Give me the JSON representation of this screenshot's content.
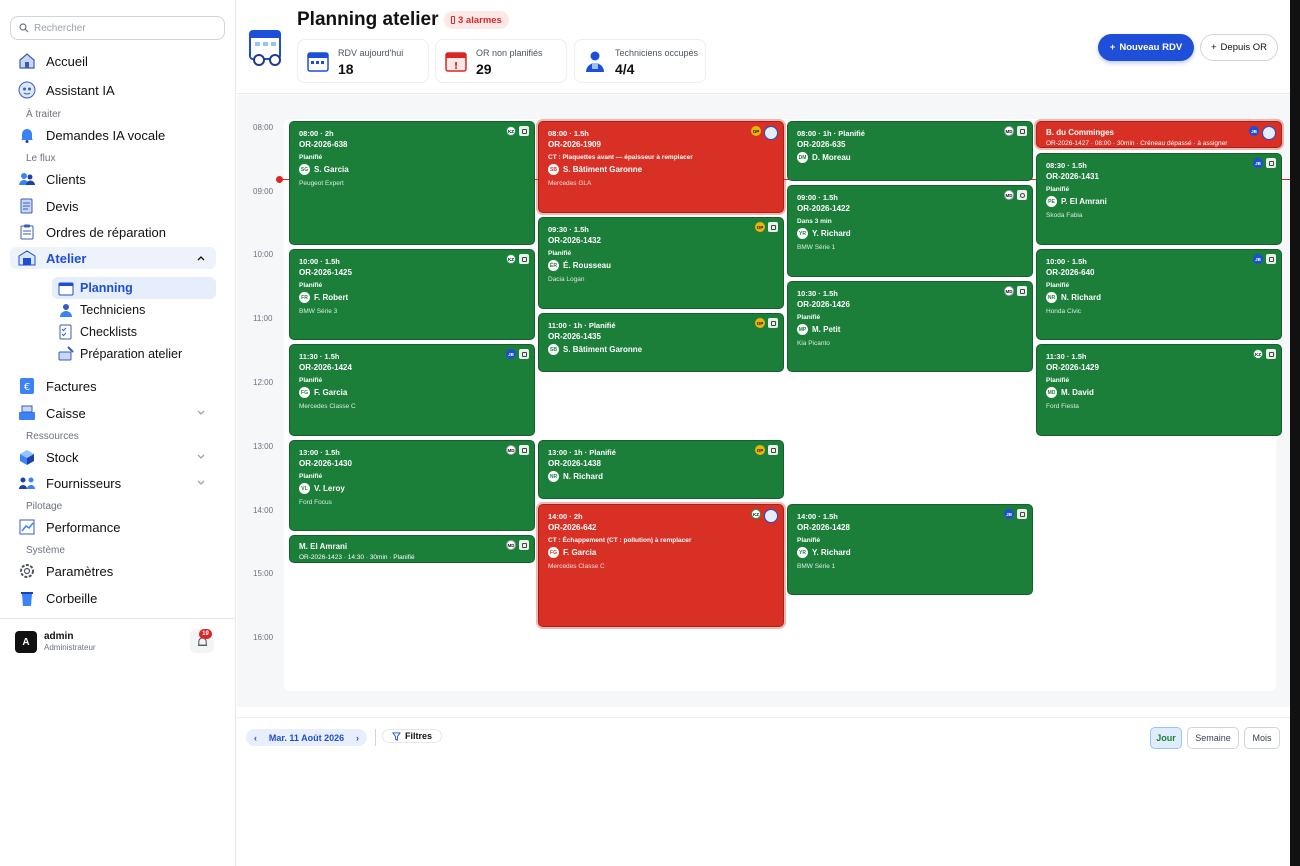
{
  "sidebar": {
    "search_placeholder": "Rechercher",
    "nav": {
      "accueil": "Accueil",
      "assistant": "Assistant IA",
      "sec_traiter": "À traiter",
      "demandes": "Demandes IA vocale",
      "sec_flux": "Le flux",
      "clients": "Clients",
      "devis": "Devis",
      "ordres": "Ordres de réparation",
      "atelier": "Atelier",
      "planning": "Planning",
      "techniciens": "Techniciens",
      "checklists": "Checklists",
      "preparation": "Préparation atelier",
      "factures": "Factures",
      "caisse": "Caisse",
      "sec_ressources": "Ressources",
      "stock": "Stock",
      "fournisseurs": "Fournisseurs",
      "sec_pilotage": "Pilotage",
      "performance": "Performance",
      "sec_systeme": "Système",
      "parametres": "Paramètres",
      "corbeille": "Corbeille"
    },
    "user": {
      "initial": "A",
      "name": "admin",
      "role": "Administrateur",
      "notifications": "19"
    }
  },
  "header": {
    "title": "Planning atelier",
    "alarm": "3 alarmes",
    "stats": [
      {
        "label": "RDV aujourd'hui",
        "value": "18"
      },
      {
        "label": "OR non planifiés",
        "value": "29"
      },
      {
        "label": "Techniciens occupés",
        "value": "4/4"
      }
    ],
    "new_rdv": "Nouveau RDV",
    "depuis_or": "Depuis OR"
  },
  "calendar": {
    "hours": [
      "08:00",
      "09:00",
      "10:00",
      "11:00",
      "12:00",
      "13:00",
      "14:00",
      "15:00",
      "16:00"
    ],
    "events": {
      "e1": {
        "time": "08:00 · 2h",
        "or": "OR-2026-638",
        "status": "Planifié",
        "tech_initials": "SG",
        "tech": "S. Garcia",
        "car": "Peugeot Expert",
        "tag": "KZ"
      },
      "e2": {
        "time": "10:00 · 1.5h",
        "or": "OR-2026-1425",
        "status": "Planifié",
        "tech_initials": "FR",
        "tech": "F. Robert",
        "car": "BMW Série 3",
        "tag": "KZ"
      },
      "e3": {
        "time": "11:30 · 1.5h",
        "or": "OR-2026-1424",
        "status": "Planifié",
        "tech_initials": "FG",
        "tech": "F. Garcia",
        "car": "Mercedes Classe C",
        "tag": "JB"
      },
      "e4": {
        "time": "13:00 · 1.5h",
        "or": "OR-2026-1430",
        "status": "Planifié",
        "tech_initials": "VL",
        "tech": "V. Leroy",
        "car": "Ford Focus",
        "tag": "MD"
      },
      "e5": {
        "title": "M. El Amrani",
        "sub": "OR-2026-1423 · 14:30 · 30min · Planifié",
        "tag": "MD"
      },
      "e6": {
        "time": "08:00 · 1.5h",
        "or": "OR-2026-1909",
        "status": "CT : Plaquettes avant — épaisseur à remplacer",
        "tech_initials": "SB",
        "tech": "S. Bâtiment Garonne",
        "car": "Mercedes GLA",
        "tag": "OP"
      },
      "e7": {
        "time": "09:30 · 1.5h",
        "or": "OR-2026-1432",
        "status": "Planifié",
        "tech_initials": "ÉR",
        "tech": "É. Rousseau",
        "car": "Dacia Logan",
        "tag": "OP"
      },
      "e8": {
        "time": "11:00 · 1h · Planifié",
        "or": "OR-2026-1435",
        "tech_initials": "SB",
        "tech": "S. Bâtiment Garonne",
        "tag": "OP"
      },
      "e9": {
        "time": "13:00 · 1h · Planifié",
        "or": "OR-2026-1438",
        "tech_initials": "NR",
        "tech": "N. Richard",
        "tag": "OP"
      },
      "e10": {
        "time": "14:00 · 2h",
        "or": "OR-2026-642",
        "status": "CT : Échappement (CT : pollution) à remplacer",
        "tech_initials": "FG",
        "tech": "F. Garcia",
        "car": "Mercedes Classe C",
        "tag": "KZ"
      },
      "e11": {
        "time": "08:00 · 1h · Planifié",
        "or": "OR-2026-635",
        "tech_initials": "DM",
        "tech": "D. Moreau",
        "tag": "MD"
      },
      "e12": {
        "time": "09:00 · 1.5h",
        "or": "OR-2026-1422",
        "status": "Dans 3 min",
        "tech_initials": "YR",
        "tech": "Y. Richard",
        "car": "BMW Série 1",
        "tag": "MD"
      },
      "e13": {
        "time": "10:30 · 1.5h",
        "or": "OR-2026-1426",
        "status": "Planifié",
        "tech_initials": "MP",
        "tech": "M. Petit",
        "car": "Kia Picanto",
        "tag": "MD"
      },
      "e14": {
        "time": "14:00 · 1.5h",
        "or": "OR-2026-1428",
        "status": "Planifié",
        "tech_initials": "YR",
        "tech": "Y. Richard",
        "car": "BMW Série 1",
        "tag": "JB"
      },
      "e15": {
        "title": "B. du Comminges",
        "sub": "OR-2026-1427 · 08:00 · 30min · Créneau dépassé · à assigner",
        "tag": "JB"
      },
      "e16": {
        "time": "08:30 · 1.5h",
        "or": "OR-2026-1431",
        "status": "Planifié",
        "tech_initials": "PE",
        "tech": "P. El Amrani",
        "car": "Skoda Fabia",
        "tag": "JB"
      },
      "e17": {
        "time": "10:00 · 1.5h",
        "or": "OR-2026-640",
        "status": "Planifié",
        "tech_initials": "NR",
        "tech": "N. Richard",
        "car": "Honda Civic",
        "tag": "JB"
      },
      "e18": {
        "time": "11:30 · 1.5h",
        "or": "OR-2026-1429",
        "status": "Planifié",
        "tech_initials": "MD",
        "tech": "M. David",
        "car": "Ford Fiesta",
        "tag": "KZ"
      }
    }
  },
  "footer": {
    "date": "Mar. 11 Août 2026",
    "filters": "Filtres",
    "views": {
      "day": "Jour",
      "week": "Semaine",
      "month": "Mois"
    }
  }
}
